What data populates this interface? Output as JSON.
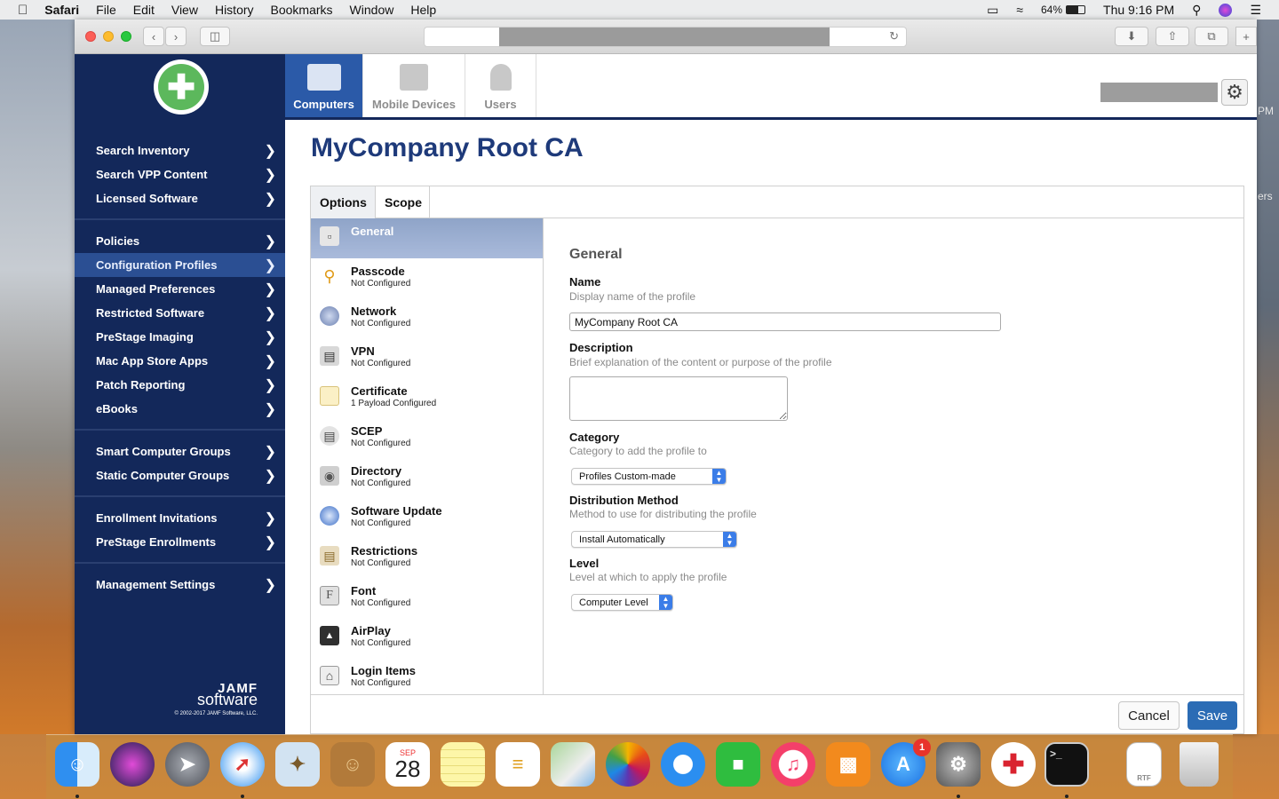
{
  "menubar": {
    "app": "Safari",
    "items": [
      "File",
      "Edit",
      "View",
      "History",
      "Bookmarks",
      "Window",
      "Help"
    ],
    "battery": "64%",
    "clock": "Thu 9:16 PM"
  },
  "desktop": {
    "right_text_1": "PM",
    "right_text_2": "ers"
  },
  "sidebar": {
    "group1": [
      "Search Inventory",
      "Search VPP Content",
      "Licensed Software"
    ],
    "group2": [
      "Policies",
      "Configuration Profiles",
      "Managed Preferences",
      "Restricted Software",
      "PreStage Imaging",
      "Mac App Store Apps",
      "Patch Reporting",
      "eBooks"
    ],
    "group3": [
      "Smart Computer Groups",
      "Static Computer Groups"
    ],
    "group4": [
      "Enrollment Invitations",
      "PreStage Enrollments"
    ],
    "group5": [
      "Management Settings"
    ],
    "active": "Configuration Profiles",
    "brand_top": "JAMF",
    "brand_bottom": "software",
    "copyright": "© 2002-2017 JAMF Software, LLC."
  },
  "topnav": {
    "tabs": [
      "Computers",
      "Mobile Devices",
      "Users"
    ],
    "active": "Computers"
  },
  "page": {
    "title": "MyCompany Root CA"
  },
  "panel_tabs": [
    "Options",
    "Scope"
  ],
  "payloads": [
    {
      "name": "General",
      "status": "",
      "icon": "general-icon"
    },
    {
      "name": "Passcode",
      "status": "Not Configured",
      "icon": "key-icon"
    },
    {
      "name": "Network",
      "status": "Not Configured",
      "icon": "globe-icon"
    },
    {
      "name": "VPN",
      "status": "Not Configured",
      "icon": "lock-icon"
    },
    {
      "name": "Certificate",
      "status": "1 Payload Configured",
      "icon": "certificate-icon"
    },
    {
      "name": "SCEP",
      "status": "Not Configured",
      "icon": "scep-lock-icon"
    },
    {
      "name": "Directory",
      "status": "Not Configured",
      "icon": "directory-icon"
    },
    {
      "name": "Software Update",
      "status": "Not Configured",
      "icon": "software-update-icon"
    },
    {
      "name": "Restrictions",
      "status": "Not Configured",
      "icon": "restrictions-icon"
    },
    {
      "name": "Font",
      "status": "Not Configured",
      "icon": "font-icon"
    },
    {
      "name": "AirPlay",
      "status": "Not Configured",
      "icon": "airplay-icon"
    },
    {
      "name": "Login Items",
      "status": "Not Configured",
      "icon": "login-items-icon"
    }
  ],
  "form": {
    "section": "General",
    "name_label": "Name",
    "name_hint": "Display name of the profile",
    "name_value": "MyCompany Root CA",
    "desc_label": "Description",
    "desc_hint": "Brief explanation of the content or purpose of the profile",
    "desc_value": "",
    "cat_label": "Category",
    "cat_hint": "Category to add the profile to",
    "cat_value": "Profiles Custom-made",
    "dist_label": "Distribution Method",
    "dist_hint": "Method to use for distributing the profile",
    "dist_value": "Install Automatically",
    "level_label": "Level",
    "level_hint": "Level at which to apply the profile",
    "level_value": "Computer Level"
  },
  "buttons": {
    "cancel": "Cancel",
    "save": "Save"
  },
  "dock": {
    "calendar_month": "SEP",
    "calendar_day": "28",
    "appstore_badge": "1",
    "doc_label": "RTF"
  }
}
